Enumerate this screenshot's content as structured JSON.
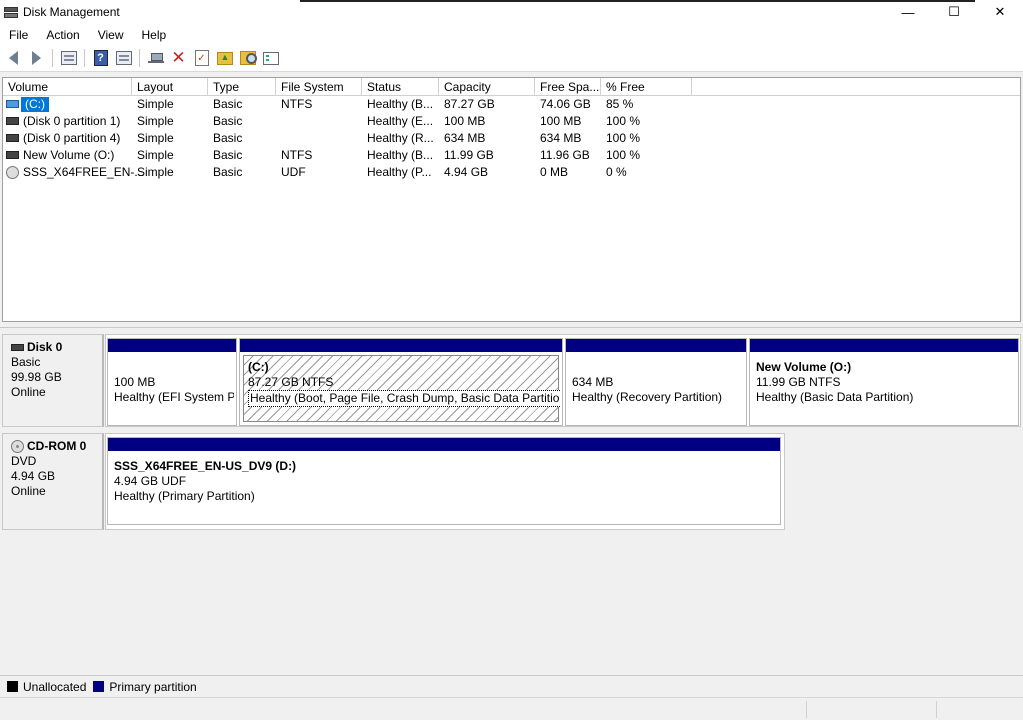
{
  "window": {
    "title": "Disk Management",
    "controls": {
      "minimize": "—",
      "maximize": "☐",
      "close": "✕"
    }
  },
  "menu": [
    "File",
    "Action",
    "View",
    "Help"
  ],
  "toolbar": {
    "icons": [
      "back-arrow-icon",
      "forward-arrow-icon",
      "properties-icon",
      "help-icon",
      "connect-drive-icon",
      "delete-icon",
      "check-icon",
      "folder-up-icon",
      "explore-icon",
      "settings-list-icon"
    ]
  },
  "volume_list": {
    "columns": [
      "Volume",
      "Layout",
      "Type",
      "File System",
      "Status",
      "Capacity",
      "Free Spa...",
      "% Free"
    ],
    "rows": [
      {
        "volume": "(C:)",
        "layout": "Simple",
        "type": "Basic",
        "fs": "NTFS",
        "status": "Healthy (B...",
        "capacity": "87.27 GB",
        "free": "74.06 GB",
        "pct": "85 %",
        "icon": "windows-volume-icon",
        "selected": true
      },
      {
        "volume": "(Disk 0 partition 1)",
        "layout": "Simple",
        "type": "Basic",
        "fs": "",
        "status": "Healthy (E...",
        "capacity": "100 MB",
        "free": "100 MB",
        "pct": "100 %",
        "icon": "volume-icon"
      },
      {
        "volume": "(Disk 0 partition 4)",
        "layout": "Simple",
        "type": "Basic",
        "fs": "",
        "status": "Healthy (R...",
        "capacity": "634 MB",
        "free": "634 MB",
        "pct": "100 %",
        "icon": "volume-icon"
      },
      {
        "volume": "New Volume (O:)",
        "layout": "Simple",
        "type": "Basic",
        "fs": "NTFS",
        "status": "Healthy (B...",
        "capacity": "11.99 GB",
        "free": "11.96 GB",
        "pct": "100 %",
        "icon": "volume-icon"
      },
      {
        "volume": "SSS_X64FREE_EN-...",
        "layout": "Simple",
        "type": "Basic",
        "fs": "UDF",
        "status": "Healthy (P...",
        "capacity": "4.94 GB",
        "free": "0 MB",
        "pct": "0 %",
        "icon": "cdrom-icon"
      }
    ]
  },
  "disks": [
    {
      "name": "Disk 0",
      "kind": "Basic",
      "size": "99.98 GB",
      "state": "Online",
      "partitions": [
        {
          "name": "",
          "size": "100 MB",
          "status": "Healthy (EFI System Partition)"
        },
        {
          "name": "(C:)",
          "size": "87.27 GB NTFS",
          "status": "Healthy (Boot, Page File, Crash Dump, Basic Data Partition)",
          "selected": true
        },
        {
          "name": "",
          "size": "634 MB",
          "status": "Healthy (Recovery Partition)"
        },
        {
          "name": "New Volume  (O:)",
          "size": "11.99 GB NTFS",
          "status": "Healthy (Basic Data Partition)"
        }
      ]
    },
    {
      "name": "CD-ROM 0",
      "kind": "DVD",
      "size": "4.94 GB",
      "state": "Online",
      "partitions": [
        {
          "name": "SSS_X64FREE_EN-US_DV9  (D:)",
          "size": "4.94 GB UDF",
          "status": "Healthy (Primary Partition)"
        }
      ]
    }
  ],
  "legend": [
    {
      "label": "Unallocated",
      "color": "#000000"
    },
    {
      "label": "Primary partition",
      "color": "#000080"
    }
  ],
  "colors": {
    "partition_bar": "#000080",
    "selection": "#0078d7"
  }
}
